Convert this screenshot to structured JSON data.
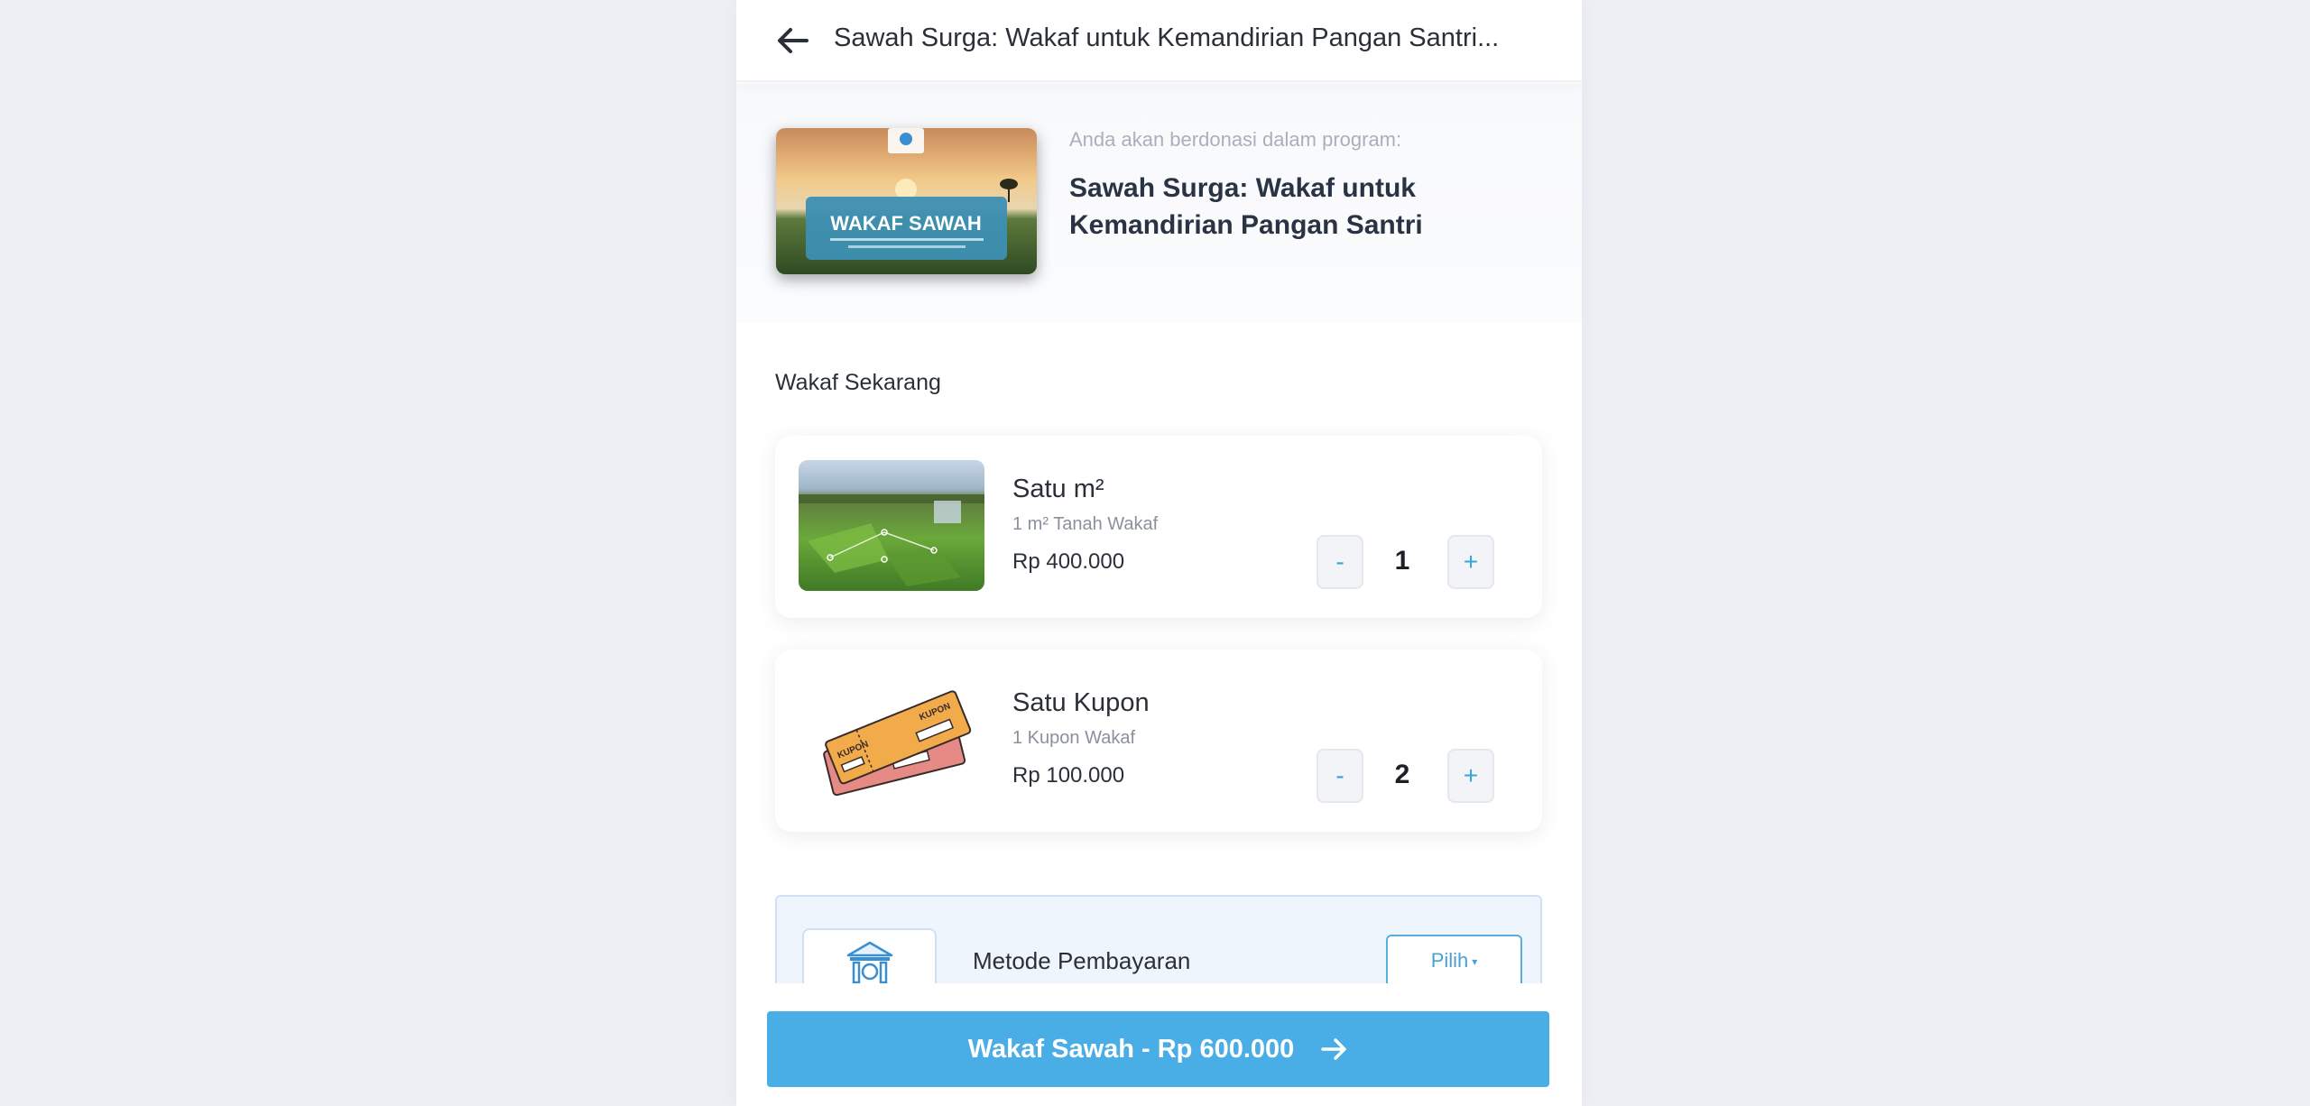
{
  "header": {
    "title": "Sawah Surga: Wakaf untuk Kemandirian Pangan Santri..."
  },
  "program": {
    "intro": "Anda akan berdonasi dalam program:",
    "name": "Sawah Surga: Wakaf untuk Kemandirian Pangan Santri",
    "banner_title": "WAKAF SAWAH"
  },
  "section": {
    "title": "Wakaf Sekarang"
  },
  "products": [
    {
      "name": "Satu m²",
      "subtitle": "1 m² Tanah Wakaf",
      "price": "Rp 400.000",
      "quantity": "1",
      "minus": "-",
      "plus": "+"
    },
    {
      "name": "Satu Kupon",
      "subtitle": "1 Kupon Wakaf",
      "price": "Rp 100.000",
      "quantity": "2",
      "minus": "-",
      "plus": "+",
      "ticket_text": "KUPON"
    }
  ],
  "payment": {
    "label": "Metode Pembayaran",
    "select_label": "Pilih"
  },
  "footer": {
    "cta_label": "Wakaf Sawah - Rp 600.000"
  },
  "colors": {
    "accent": "#4aaee6",
    "qty_symbol": "#3aa3dc",
    "title_dark": "#2a3344"
  }
}
